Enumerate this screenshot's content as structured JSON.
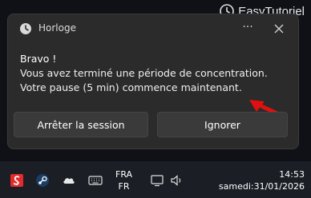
{
  "watermark": {
    "text": "EasyTutoriel"
  },
  "notification": {
    "app_name": "Horloge",
    "more_label": "···",
    "title": "Bravo !",
    "lines": [
      "Vous avez terminé une période de concentration.",
      "Votre pause (5 min) commence maintenant."
    ],
    "buttons": {
      "stop": "Arrêter la session",
      "ignore": "Ignorer"
    }
  },
  "taskbar": {
    "language": {
      "top": "FRA",
      "bottom": "FR"
    },
    "clock": {
      "time": "14:53",
      "date": "samedi:31/01/2026"
    },
    "icons": [
      "app-red-icon",
      "steam-icon",
      "cloud-icon",
      "keyboard-icon",
      "display-icon",
      "volume-icon"
    ]
  },
  "colors": {
    "toast_bg": "#2b2b2b",
    "button_bg": "#3a3a3a",
    "arrow": "#e01010",
    "taskbar_bg": "#1b1e24"
  }
}
